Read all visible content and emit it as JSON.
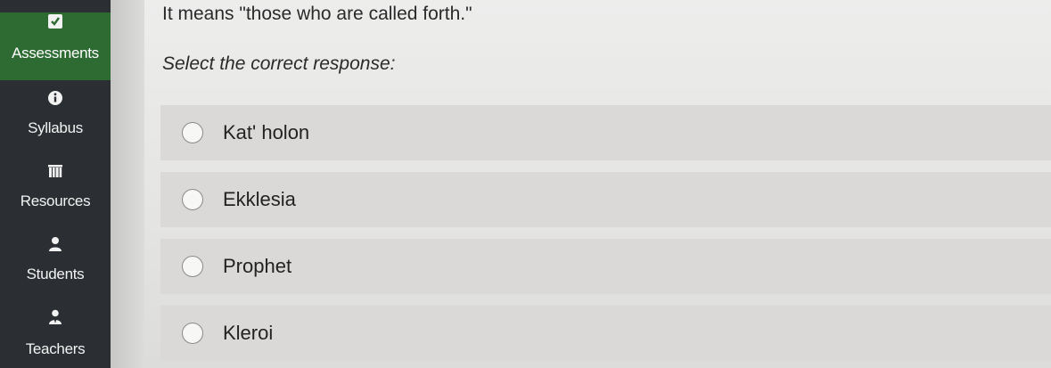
{
  "sidebar": {
    "items": [
      {
        "label": "Assessments",
        "icon": "checkbox-icon",
        "active": true
      },
      {
        "label": "Syllabus",
        "icon": "info-icon"
      },
      {
        "label": "Resources",
        "icon": "books-icon"
      },
      {
        "label": "Students",
        "icon": "person-icon"
      },
      {
        "label": "Teachers",
        "icon": "teacher-icon"
      }
    ],
    "active_color": "#2e6b33",
    "background_color": "#2b2f33"
  },
  "question": {
    "text": "It means \"those who are called forth.\"",
    "instruction": "Select the correct response:"
  },
  "options": [
    {
      "label": "Kat' holon",
      "selected": false
    },
    {
      "label": "Ekklesia",
      "selected": false
    },
    {
      "label": "Prophet",
      "selected": false
    },
    {
      "label": "Kleroi",
      "selected": false
    }
  ]
}
